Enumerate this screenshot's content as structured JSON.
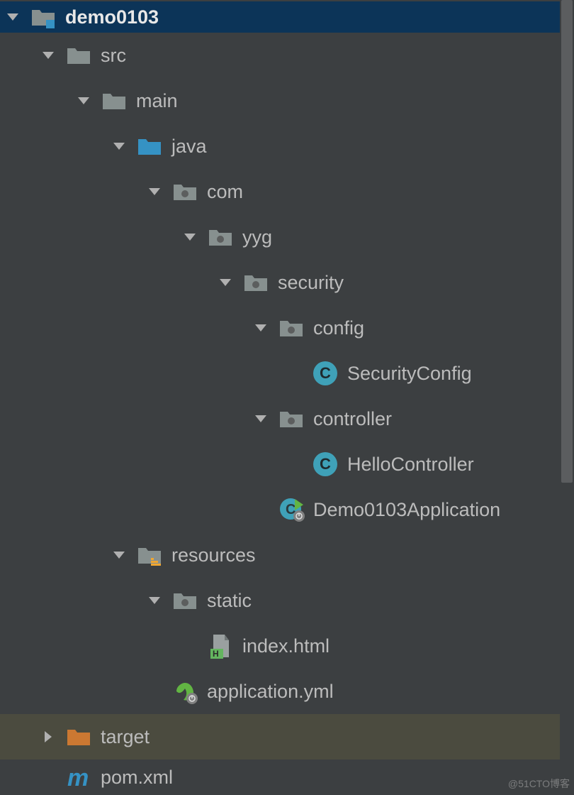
{
  "tree": {
    "root": "demo0103",
    "src": "src",
    "main": "main",
    "java": "java",
    "com": "com",
    "yyg": "yyg",
    "security": "security",
    "config": "config",
    "securityConfig": "SecurityConfig",
    "controller": "controller",
    "helloController": "HelloController",
    "demoApp": "Demo0103Application",
    "resources": "resources",
    "static": "static",
    "indexHtml": "index.html",
    "appYml": "application.yml",
    "target": "target",
    "pomXml": "pom.xml"
  },
  "watermark": "@51CTO博客"
}
